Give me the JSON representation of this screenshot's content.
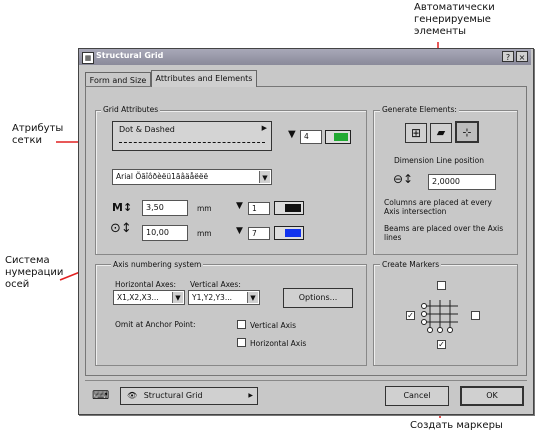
{
  "annotations": {
    "top_right": "Автоматически\nгенерируемые\nэлементы",
    "left_top": "Атрибуты\nсетки",
    "left_bottom": "Система\nнумерации\nосей",
    "bottom": "Создать маркеры"
  },
  "window": {
    "title": "Structural Grid",
    "help": "?",
    "close": "×"
  },
  "tabs": [
    {
      "label": "Form and Size"
    },
    {
      "label": "Attributes and Elements"
    }
  ],
  "grid_attributes": {
    "title": "Grid Attributes",
    "line_type": "Dot & Dashed",
    "pen_value": "4",
    "pen_color": "#22aa33",
    "font_name": "Arial Õãîôðèëü1ãâäåëëë",
    "size_value": "3,50",
    "size_unit": "mm",
    "size_pen": "1",
    "size_pen_color": "#111111",
    "diam_value": "10,00",
    "diam_unit": "mm",
    "diam_pen": "7",
    "diam_pen_color": "#1133ee"
  },
  "axis_numbering": {
    "title": "Axis numbering system",
    "horizontal_label": "Horizontal Axes:",
    "horizontal_value": "X1,X2,X3...",
    "vertical_label": "Vertical Axes:",
    "vertical_value": "Y1,Y2,Y3...",
    "options_button": "Options...",
    "omit_label": "Omit at Anchor Point:",
    "vertical_axis": "Vertical Axis",
    "horizontal_axis": "Horizontal Axis"
  },
  "generate_elements": {
    "title": "Generate Elements:",
    "dimension_label": "Dimension Line position",
    "dimension_value": "2,0000",
    "columns_text": "Columns are placed at every Axis intersection",
    "beams_text": "Beams are placed over the Axis lines"
  },
  "create_markers": {
    "title": "Create Markers",
    "left_checked": "✓",
    "bottom_checked": "✓"
  },
  "footer": {
    "tool_name": "Structural Grid",
    "cancel": "Cancel",
    "ok": "OK"
  }
}
